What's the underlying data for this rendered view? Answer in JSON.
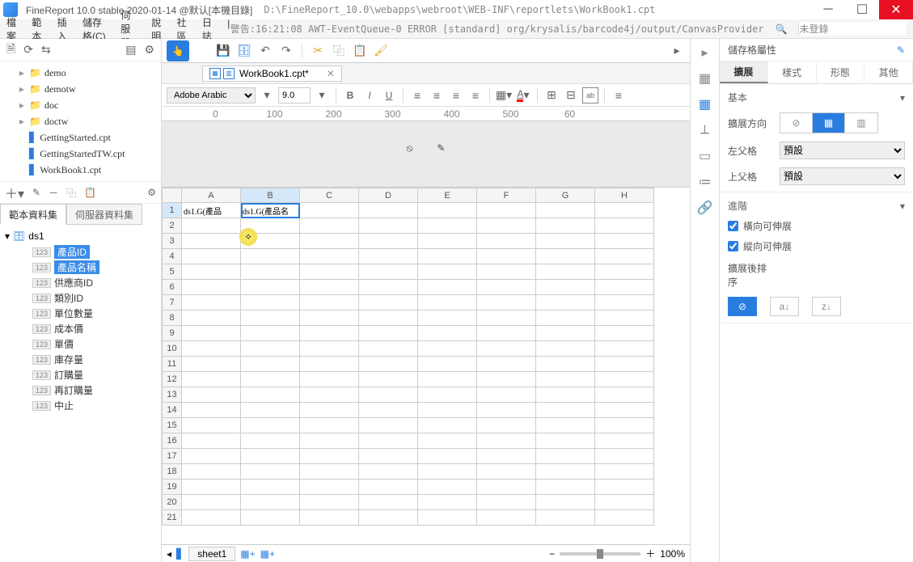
{
  "title": {
    "app": "FineReport 10.0 stable 2020-01-14 @默认[本機目錄]",
    "path": "D:\\FineReport_10.0\\webapps\\webroot\\WEB-INF\\reportlets\\WorkBook1.cpt"
  },
  "menu": {
    "items": [
      "檔案",
      "範本",
      "插入",
      "儲存格(C)",
      "伺服器",
      "說明",
      "社區",
      "日誌"
    ],
    "status": "警告:16:21:08 AWT-EventQueue-0 ERROR [standard] org/krysalis/barcode4j/output/CanvasProvider",
    "right": "未登錄"
  },
  "fileTree": [
    {
      "type": "folder",
      "name": "demo"
    },
    {
      "type": "folder",
      "name": "demotw"
    },
    {
      "type": "folder",
      "name": "doc"
    },
    {
      "type": "folder",
      "name": "doctw"
    },
    {
      "type": "file",
      "name": "GettingStarted.cpt"
    },
    {
      "type": "file",
      "name": "GettingStartedTW.cpt"
    },
    {
      "type": "file",
      "name": "WorkBook1.cpt"
    }
  ],
  "dsTabs": {
    "a": "範本資料集",
    "b": "伺服器資料集"
  },
  "ds": {
    "root": "ds1",
    "fields": [
      {
        "name": "產品ID",
        "sel": true
      },
      {
        "name": "產品名稱",
        "sel": true
      },
      {
        "name": "供應商ID",
        "sel": false
      },
      {
        "name": "類別ID",
        "sel": false
      },
      {
        "name": "單位數量",
        "sel": false
      },
      {
        "name": "成本價",
        "sel": false
      },
      {
        "name": "單價",
        "sel": false
      },
      {
        "name": "庫存量",
        "sel": false
      },
      {
        "name": "訂購量",
        "sel": false
      },
      {
        "name": "再訂購量",
        "sel": false
      },
      {
        "name": "中止",
        "sel": false
      }
    ]
  },
  "fileTab": {
    "name": "WorkBook1.cpt*"
  },
  "format": {
    "font": "Adobe Arabic",
    "size": "9.0"
  },
  "ruler": [
    "0",
    "100",
    "200",
    "300",
    "400",
    "500",
    "60"
  ],
  "cols": [
    "A",
    "B",
    "C",
    "D",
    "E",
    "F",
    "G",
    "H"
  ],
  "rows": 21,
  "cells": {
    "A1": "ds1.G(產品",
    "B1": "ds1.G(產品名"
  },
  "selectedCell": "B1",
  "selectedCol": "B",
  "selectedRow": 1,
  "sheet": {
    "name": "sheet1",
    "zoom": "100%"
  },
  "rightPanel": {
    "title": "儲存格屬性",
    "tabs": [
      "擴展",
      "樣式",
      "形態",
      "其他"
    ],
    "section1": "基本",
    "expandDir": "擴展方向",
    "leftParent": "左父格",
    "upParent": "上父格",
    "parentDefault": "預設",
    "section2": "進階",
    "chk1": "橫向可伸展",
    "chk2": "縱向可伸展",
    "sortLabel": "擴展後排序"
  }
}
